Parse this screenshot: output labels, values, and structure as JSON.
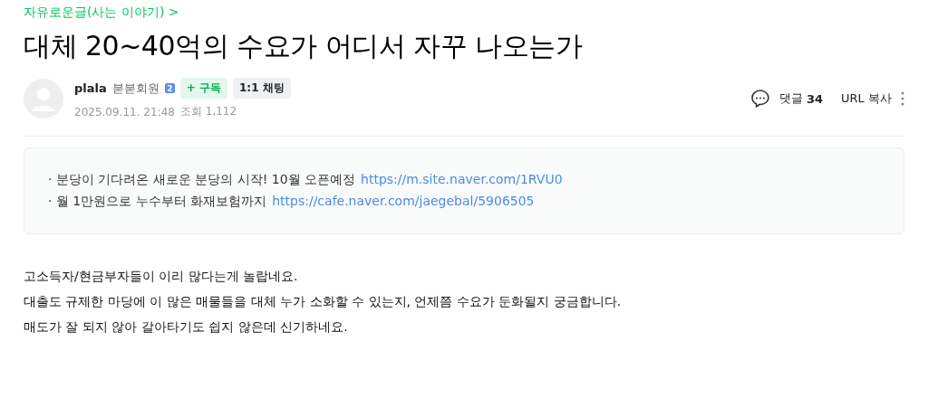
{
  "board": {
    "name": "자유로운글(사는 이야기)",
    "arrow": ">"
  },
  "title": "대체 20~40억의 수요가 어디서 자꾸 나오는가",
  "author": {
    "name": "plala",
    "grade": "붇붇회원",
    "level_badge": "2",
    "subscribe": "+ 구독",
    "chat": "1:1 채팅",
    "date": "2025.09.11. 21:48",
    "views_label": "조회",
    "views": "1,112"
  },
  "actions": {
    "comments_label": "댓글",
    "comments": "34",
    "url_copy": "URL 복사"
  },
  "notices": [
    {
      "bullet": "·",
      "text": "분당이 기다려온 새로운 분당의 시작! 10월 오픈예정",
      "link": "https://m.site.naver.com/1RVU0"
    },
    {
      "bullet": "·",
      "text": "월 1만원으로 누수부터 화재보험까지",
      "link": "https://cafe.naver.com/jaegebal/5906505"
    }
  ],
  "body": [
    "고소득자/현금부자들이 이리 많다는게 놀랍네요.",
    "대출도 규제한 마당에 이 많은 매물들을 대체 누가 소화할 수 있는지, 언제쯤 수요가 둔화될지 궁금합니다.",
    "매도가 잘 되지 않아 갈아타기도 쉽지 않은데 신기하네요."
  ]
}
